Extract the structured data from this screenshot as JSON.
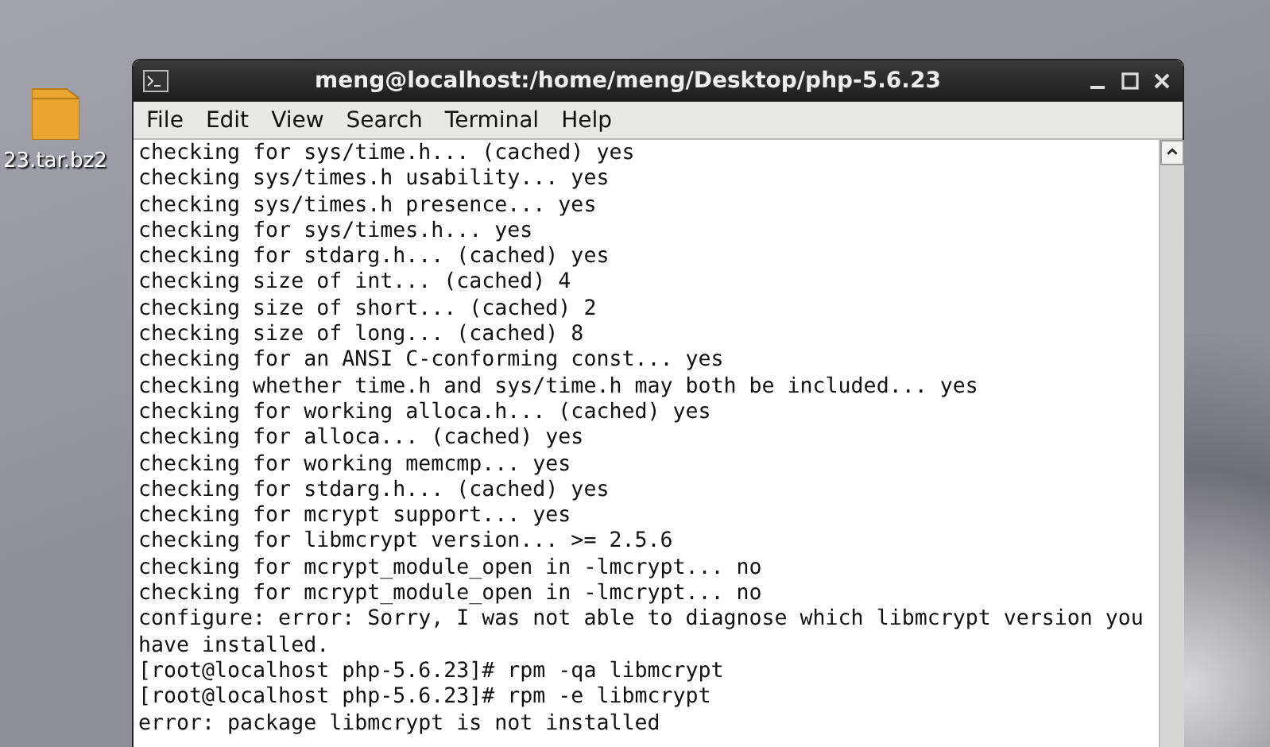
{
  "desktop": {
    "icons": [
      {
        "label": "23.tar.bz2"
      }
    ]
  },
  "window": {
    "title": "meng@localhost:/home/meng/Desktop/php-5.6.23",
    "menu": [
      "File",
      "Edit",
      "View",
      "Search",
      "Terminal",
      "Help"
    ],
    "terminal_lines": [
      "checking for sys/time.h... (cached) yes",
      "checking sys/times.h usability... yes",
      "checking sys/times.h presence... yes",
      "checking for sys/times.h... yes",
      "checking for stdarg.h... (cached) yes",
      "checking size of int... (cached) 4",
      "checking size of short... (cached) 2",
      "checking size of long... (cached) 8",
      "checking for an ANSI C-conforming const... yes",
      "checking whether time.h and sys/time.h may both be included... yes",
      "checking for working alloca.h... (cached) yes",
      "checking for alloca... (cached) yes",
      "checking for working memcmp... yes",
      "checking for stdarg.h... (cached) yes",
      "checking for mcrypt support... yes",
      "checking for libmcrypt version... >= 2.5.6",
      "checking for mcrypt_module_open in -lmcrypt... no",
      "checking for mcrypt_module_open in -lmcrypt... no",
      "configure: error: Sorry, I was not able to diagnose which libmcrypt version you have installed.",
      "[root@localhost php-5.6.23]# rpm -qa libmcrypt",
      "[root@localhost php-5.6.23]# rpm -e libmcrypt",
      "error: package libmcrypt is not installed"
    ]
  }
}
